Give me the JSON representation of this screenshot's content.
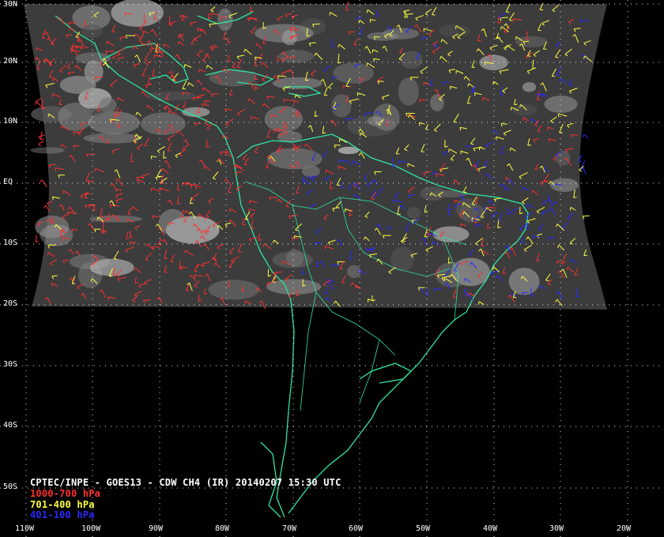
{
  "title": "CPTEC/INPE - GOES13 - CDW CH4 (IR) 20140207 15:30 UTC",
  "legend": [
    {
      "label": "1000-700 hPa",
      "color": "#ff3030"
    },
    {
      "label": "701-400 hPa",
      "color": "#ffff40"
    },
    {
      "label": "401-100 hPa",
      "color": "#2a2aff"
    }
  ],
  "latitude_labels": [
    "30N",
    "20N",
    "10N",
    "EQ",
    "10S",
    "20S",
    "30S",
    "40S",
    "50S"
  ],
  "longitude_labels": [
    "110W",
    "100W",
    "90W",
    "80W",
    "70W",
    "60W",
    "50W",
    "40W",
    "30W",
    "20W"
  ],
  "colors": {
    "coastline": "#2ee6a0",
    "grid": "#ffffff",
    "background": "#000000",
    "satellite_gray": "#3a3a3a"
  }
}
